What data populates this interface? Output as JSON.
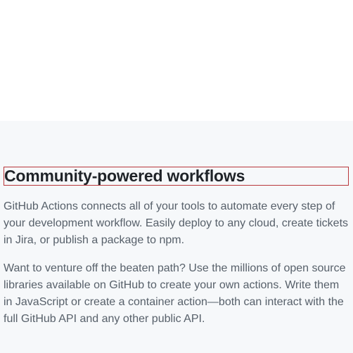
{
  "section": {
    "title": "Community-powered workflows",
    "paragraphs": [
      "GitHub Actions connects all of your tools to automate every step of your development workflow. Easily deploy to any cloud, create tickets in Jira, or publish a package to npm.",
      "Want to venture off the beaten path? Use the millions of open source libraries available on GitHub to create your own actions. Write them in JavaScript or create a container action—both can interact with the full GitHub API and any other public API."
    ]
  },
  "colors": {
    "section_background": "#f6f8fa",
    "heading_text": "#1f2328",
    "body_text": "#57606a",
    "highlight_border": "#b9363a"
  }
}
